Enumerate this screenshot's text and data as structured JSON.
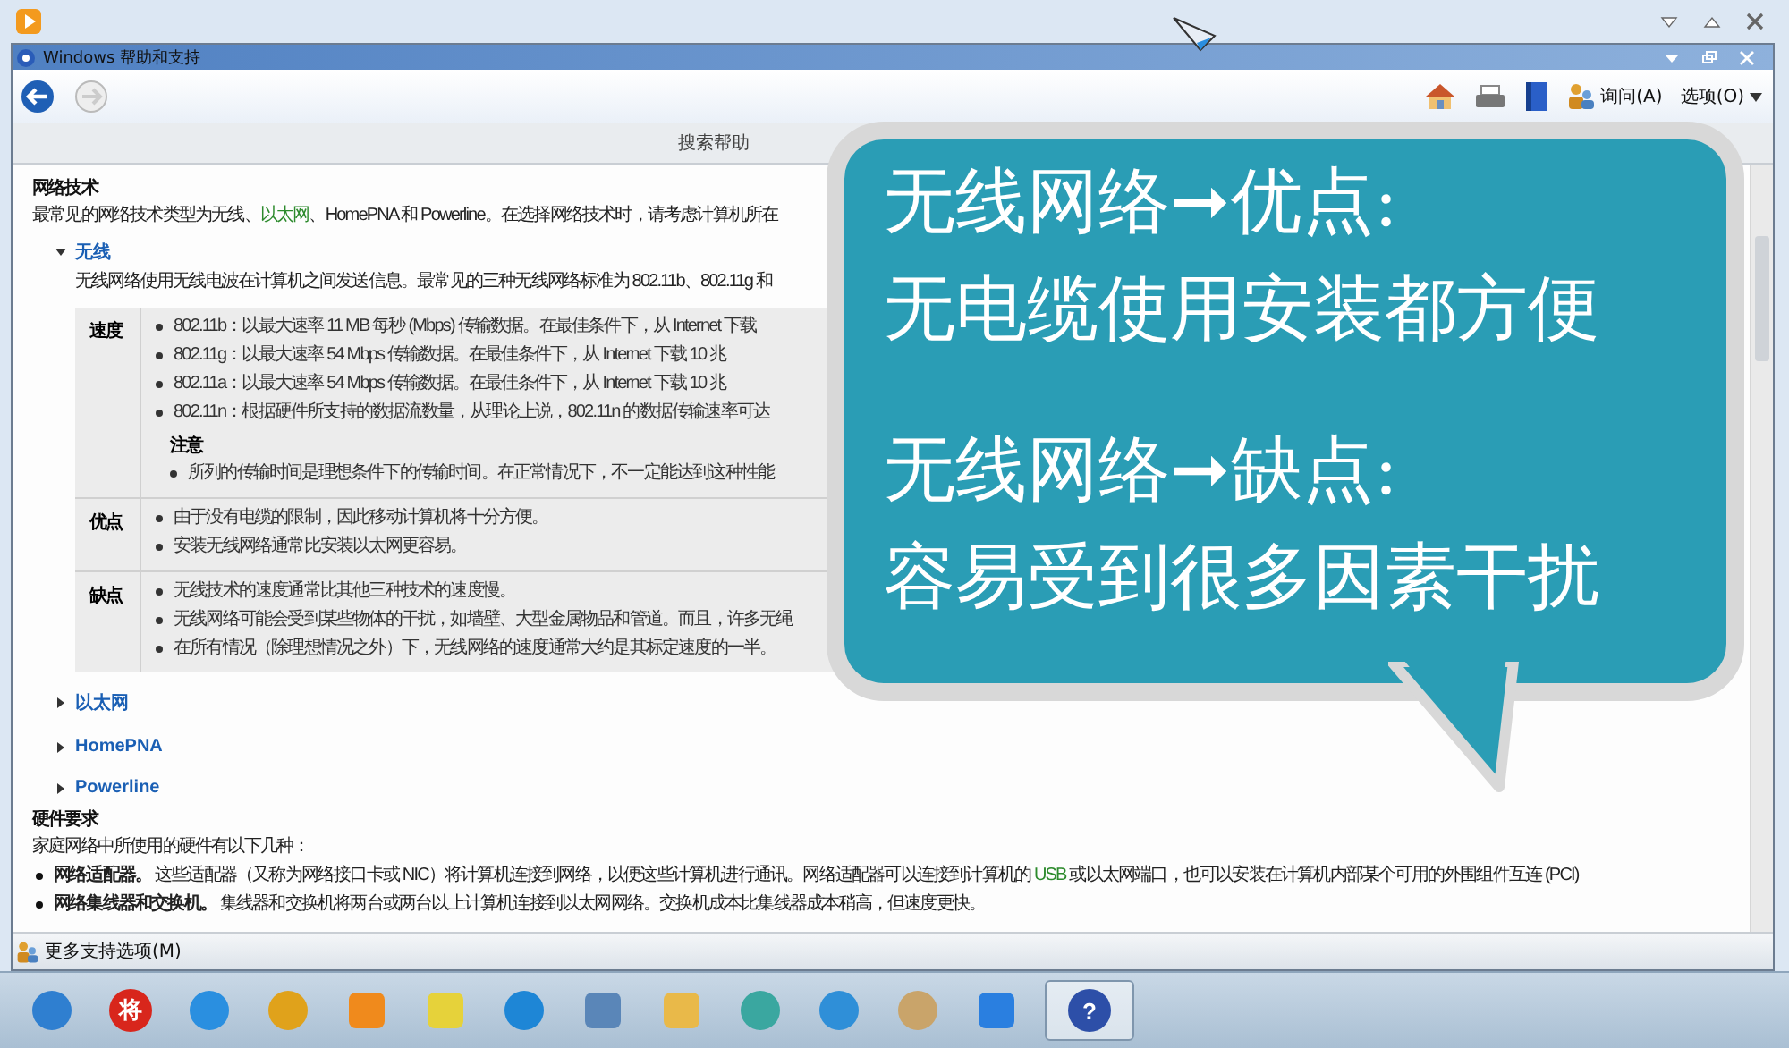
{
  "window": {
    "title": "Windows 帮助和支持"
  },
  "toolbar": {
    "ask": "询问(A)",
    "options": "选项(O)"
  },
  "search": {
    "placeholder": "搜索帮助"
  },
  "article": {
    "heading": "网络技术",
    "intro": {
      "before": "最常见的网络技术类型为无线、",
      "link": "以太网",
      "after": "、HomePNA 和 Powerline。在选择网络技术时，请考虑计算机所在"
    },
    "sections": [
      {
        "title": "无线",
        "expanded": true,
        "description": "无线网络使用无线电波在计算机之间发送信息。最常见的三种无线网络标准为 802.11b、802.11g 和",
        "table": [
          {
            "label": "速度",
            "items": [
              "802.11b：以最大速率 11 MB 每秒 (Mbps) 传输数据。在最佳条件下，从 Internet 下载",
              "802.11g：以最大速率 54 Mbps 传输数据。在最佳条件下，从 Internet 下载 10 兆",
              "802.11a：以最大速率 54 Mbps 传输数据。在最佳条件下，从 Internet 下载 10 兆",
              "802.11n：根据硬件所支持的数据流数量，从理论上说，802.11n 的数据传输速率可达"
            ],
            "note": {
              "title": "注意",
              "items": [
                "所列的传输时间是理想条件下的传输时间。在正常情况下，不一定能达到这种性能"
              ]
            }
          },
          {
            "label": "优点",
            "items": [
              "由于没有电缆的限制，因此移动计算机将十分方便。",
              "安装无线网络通常比安装以太网更容易。"
            ]
          },
          {
            "label": "缺点",
            "items": [
              "无线技术的速度通常比其他三种技术的速度慢。",
              "无线网络可能会受到某些物体的干扰，如墙壁、大型金属物品和管道。而且，许多无绳",
              "在所有情况（除理想情况之外）下，无线网络的速度通常大约是其标定速度的一半。"
            ]
          }
        ]
      },
      {
        "title": "以太网",
        "expanded": false
      },
      {
        "title": "HomePNA",
        "expanded": false
      },
      {
        "title": "Powerline",
        "expanded": false
      }
    ],
    "hardware": {
      "heading": "硬件要求",
      "intro": "家庭网络中所使用的硬件有以下几种：",
      "items": [
        {
          "term": "网络适配器。",
          "before": "这些适配器（又称为网络接口卡或 NIC）将计算机连接到网络，以便这些计算机进行通讯。网络适配器可以连接到计算机的 ",
          "link": "USB",
          "after": " 或以太网端口，也可以安装在计算机内部某个可用的外围组件互连 (PCI)"
        },
        {
          "term": "网络集线器和交换机。",
          "before": "集线器和交换机将两台或两台以上计算机连接到以太网网络。交换机成本比集线器成本稍高，但速度更快。"
        }
      ]
    }
  },
  "footer": {
    "more": "更多支持选项(M)"
  },
  "callout": {
    "groups": [
      [
        "无线网络➞优点:",
        "无电缆使用安装都方便"
      ],
      [
        "无线网络➞缺点:",
        "容易受到很多因素干扰"
      ]
    ]
  },
  "taskbar": {
    "apps": [
      {
        "kind": "start",
        "selected": false
      },
      {
        "kind": "badge",
        "label": "将",
        "selected": false
      },
      {
        "kind": "browser",
        "selected": false
      },
      {
        "kind": "chrome",
        "selected": false
      },
      {
        "kind": "player",
        "selected": false
      },
      {
        "kind": "notes",
        "selected": false
      },
      {
        "kind": "cloud",
        "selected": false
      },
      {
        "kind": "monitor",
        "selected": false
      },
      {
        "kind": "folder",
        "selected": false
      },
      {
        "kind": "pinwheel",
        "selected": false
      },
      {
        "kind": "reel",
        "selected": false
      },
      {
        "kind": "paint",
        "selected": false
      },
      {
        "kind": "netdisk",
        "selected": false
      },
      {
        "kind": "help",
        "label": "?",
        "selected": true
      }
    ]
  }
}
